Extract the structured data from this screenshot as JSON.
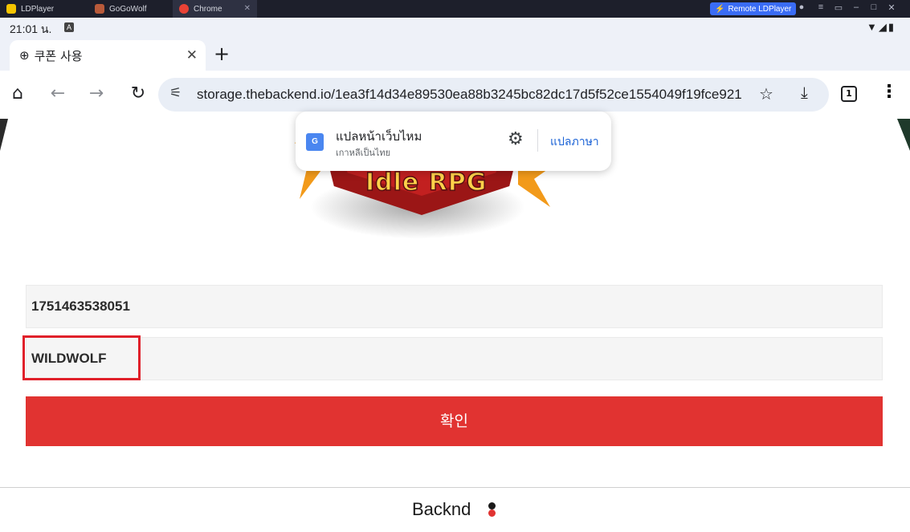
{
  "host": {
    "tabs": [
      {
        "label": "LDPlayer"
      },
      {
        "label": "GoGoWolf"
      },
      {
        "label": "Chrome"
      }
    ],
    "remote_label": "Remote LDPlayer"
  },
  "status": {
    "time": "21:01 น."
  },
  "chrome": {
    "tab_title": "쿠폰 사용",
    "url": "storage.thebackend.io/1ea3f14d34e89530ea88b3245bc82dc17d5f52ce1554049f19fce921",
    "tab_count": "1"
  },
  "translate": {
    "title": "แปลหน้าเว็บไหม",
    "subtitle": "เกาหลีเป็นไทย",
    "action": "แปลภาษา"
  },
  "page": {
    "logo_text": "Idle RPG",
    "field1_value": "1751463538051",
    "field2_value": "WILDWOLF",
    "confirm_label": "확인",
    "brand": "Backnd"
  },
  "colors": {
    "confirm": "#e13331",
    "highlight": "#e0202a",
    "remote": "#3a6cf5",
    "link": "#1a62d6"
  }
}
